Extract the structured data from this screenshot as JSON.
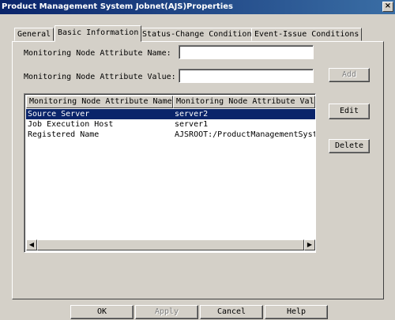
{
  "window": {
    "title": "Product Management System Jobnet(AJS)Properties",
    "close_glyph": "×"
  },
  "tabs": [
    {
      "label": "General",
      "active": false
    },
    {
      "label": "Basic Information",
      "active": true
    },
    {
      "label": "Status-Change Condition",
      "active": false
    },
    {
      "label": "Event-Issue Conditions",
      "active": false
    }
  ],
  "form": {
    "name_label": "Monitoring Node Attribute Name:",
    "name_value": "",
    "value_label": "Monitoring Node Attribute Value:",
    "value_value": ""
  },
  "side_buttons": {
    "add": "Add",
    "edit": "Edit",
    "delete": "Delete"
  },
  "list": {
    "columns": [
      "Monitoring Node Attribute Name",
      "Monitoring Node Attribute Value"
    ],
    "rows": [
      {
        "name": "Source Server",
        "value": "server2",
        "selected": true
      },
      {
        "name": "Job Execution Host",
        "value": "server1",
        "selected": false
      },
      {
        "name": "Registered Name",
        "value": "AJSROOT:/ProductManagementSyste",
        "selected": false
      }
    ]
  },
  "scrollbar": {
    "left_glyph": "◀",
    "right_glyph": "▶"
  },
  "footer": {
    "ok": "OK",
    "apply": "Apply",
    "cancel": "Cancel",
    "help": "Help"
  }
}
